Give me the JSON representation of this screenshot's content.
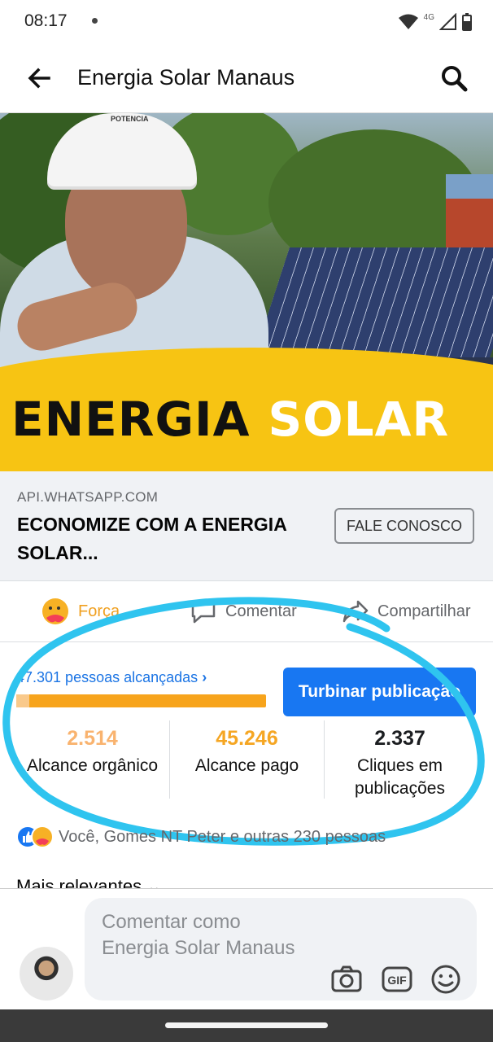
{
  "status": {
    "time": "08:17",
    "network": "4G"
  },
  "appbar": {
    "title": "Energia Solar Manaus"
  },
  "hero": {
    "banner_word1": "ENERGIA",
    "banner_word2": "SOLAR",
    "helmet_text": "POTENCIA"
  },
  "link_preview": {
    "domain": "API.WHATSAPP.COM",
    "headline": "ECONOMIZE COM A ENERGIA SOLAR...",
    "cta_label": "FALE CONOSCO"
  },
  "actions": {
    "reaction_label": "Força",
    "comment_label": "Comentar",
    "share_label": "Compartilhar"
  },
  "insights": {
    "reach_text": "47.301 pessoas alcançadas",
    "boost_label": "Turbinar publicação",
    "organic_fraction": 0.053,
    "stats": [
      {
        "value": "2.514",
        "label": "Alcance orgânico",
        "color": "#f9b36f"
      },
      {
        "value": "45.246",
        "label": "Alcance pago",
        "color": "#f5a623"
      },
      {
        "value": "2.337",
        "label": "Cliques em publicações",
        "color": "#1c1e21"
      }
    ]
  },
  "social": {
    "likes_text": "Você, Gomes NT Peter e outras 230 pessoas",
    "sort_label": "Mais relevantes"
  },
  "composer": {
    "placeholder": "Comentar como Energia Solar Manaus"
  },
  "colors": {
    "accent": "#1877f2",
    "banner": "#f7c413",
    "annotation": "#2fc4ef"
  }
}
